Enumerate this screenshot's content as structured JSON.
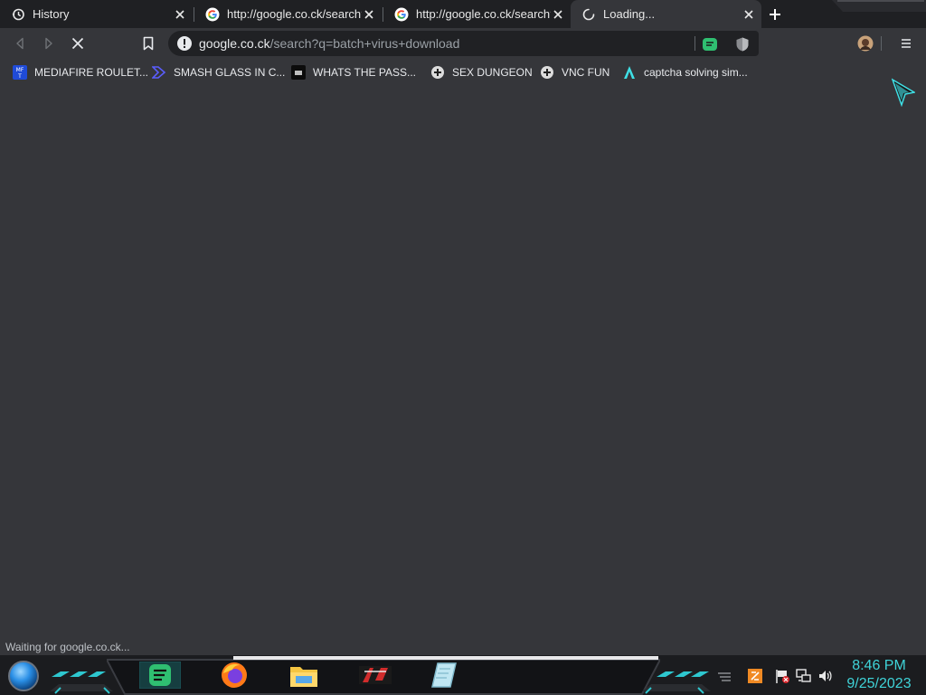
{
  "tabs": [
    {
      "title": "History",
      "icon": "history-icon",
      "active": false
    },
    {
      "title": "http://google.co.ck/search?q",
      "icon": "google-icon",
      "active": false
    },
    {
      "title": "http://google.co.ck/search?q",
      "icon": "google-icon",
      "active": false
    },
    {
      "title": "Loading...",
      "icon": "loading-spinner-icon",
      "active": true
    }
  ],
  "toolbar": {
    "url_host": "google.co.ck",
    "url_path": "/search?q=batch+virus+download"
  },
  "bookmarks": [
    {
      "label": "MEDIAFIRE ROULET...",
      "icon": "mediafire-icon"
    },
    {
      "label": "SMASH GLASS IN C...",
      "icon": "smash-glass-icon"
    },
    {
      "label": "WHATS THE PASS...",
      "icon": "password-icon"
    },
    {
      "label": "SEX DUNGEON",
      "icon": "dungeon-icon"
    },
    {
      "label": "VNC FUN",
      "icon": "vnc-icon"
    },
    {
      "label": "captcha solving sim...",
      "icon": "captcha-icon"
    }
  ],
  "status": "Waiting for google.co.ck...",
  "taskbar": {
    "time": "8:46 PM",
    "date": "9/25/2023",
    "apps": [
      "chat-app-icon",
      "firefox-icon",
      "file-explorer-icon",
      "game-icon",
      "notepad-icon"
    ]
  },
  "colors": {
    "tab_strip": "#1f2023",
    "toolbar": "#35363a",
    "omnibox": "#202124",
    "clock": "#3fd3d8",
    "accent_green": "#2fbf71"
  }
}
